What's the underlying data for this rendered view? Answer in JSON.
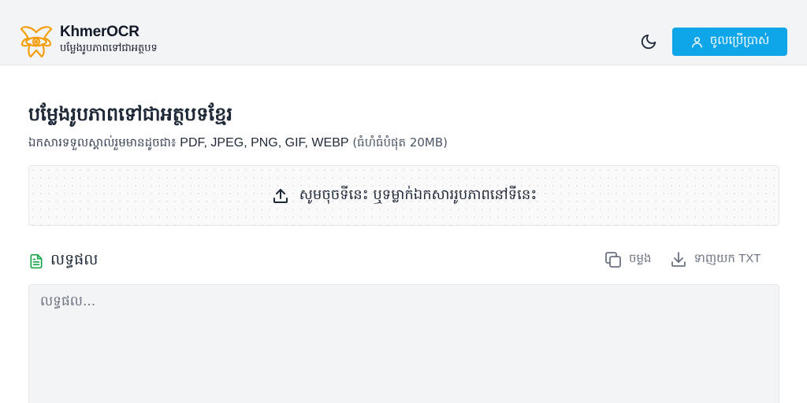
{
  "header": {
    "app_name": "KhmerOCR",
    "app_tagline": "បម្លែងរូបភាពទៅជាអត្ថបទ",
    "logo_icon": "eye-logo-icon",
    "theme_toggle_icon": "moon-icon",
    "login": {
      "label": "ចូលប្រើប្រាស់",
      "icon": "user-icon"
    }
  },
  "main": {
    "title": "បម្លែងរូបភាពទៅជាអត្ថបទខ្មែរ",
    "subtitle_prefix": "ឯកសារទទួលស្គាល់រួមមានដូចជា៖ ",
    "formats": "PDF, JPEG, PNG, GIF, WEBP",
    "limit": " (ធំហំធំបំផុត 20MB)",
    "dropzone": {
      "icon": "upload-icon",
      "label": "សូមចុចទីនេះ ឬទម្លាក់ឯកសាររូបភាពនៅទីនេះ"
    },
    "result": {
      "icon": "document-icon",
      "title": "លទ្ធផល",
      "copy_label": "ចម្លង",
      "download_label": "ទាញយក TXT",
      "placeholder": "លទ្ធផល...",
      "value": ""
    }
  },
  "colors": {
    "accent": "#0ea5e9",
    "logo": "#f59e0b",
    "document_icon": "#16a34a",
    "header_bg": "#f3f4f6"
  }
}
